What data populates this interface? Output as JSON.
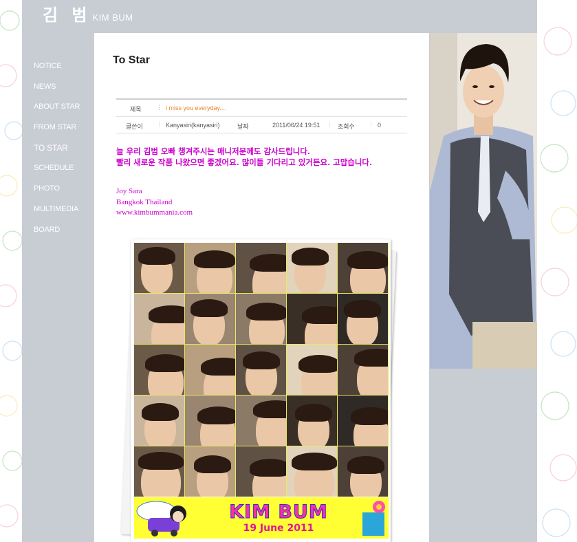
{
  "logo": {
    "korean": "김 범",
    "english": "KIM BUM"
  },
  "nav": {
    "items": [
      {
        "label": "NOTICE"
      },
      {
        "label": "NEWS"
      },
      {
        "label": "ABOUT STAR"
      },
      {
        "label": "FROM STAR"
      },
      {
        "label": "TO STAR",
        "active": true
      },
      {
        "label": "SCHEDULE"
      },
      {
        "label": "PHOTO"
      },
      {
        "label": "MULTIMEDIA"
      },
      {
        "label": "BOARD"
      }
    ]
  },
  "page": {
    "title": "To Star"
  },
  "post": {
    "subject_label": "제목",
    "subject": "i miss you everyday....",
    "author_label": "글쓴이",
    "author": "Kanyasiri(kanyasiri)",
    "date_label": "날짜",
    "date": "2011/06/24 19:51",
    "views_label": "조회수",
    "views": "0",
    "message_line1": "늘 우리 김범 오빠 챙겨주시는 매니저분께도 감사드립니다.",
    "message_line2": "빨리 새로운 작품 나왔으면 좋겠어요. 많이들 기다리고 있거든요. 고맙습니다.",
    "signature_name": "Joy Sara",
    "signature_place": "Bangkok Thailand",
    "signature_url": "www.kimbummania.com"
  },
  "collage": {
    "banner_title": "KIM BUM",
    "banner_date": "19 June 2011"
  },
  "colors": {
    "site_bg": "#c8ccd3",
    "message": "#cc00cc",
    "subject": "#e8852a",
    "banner_bg": "#ffff33",
    "banner_title": "#ff2fa0"
  }
}
